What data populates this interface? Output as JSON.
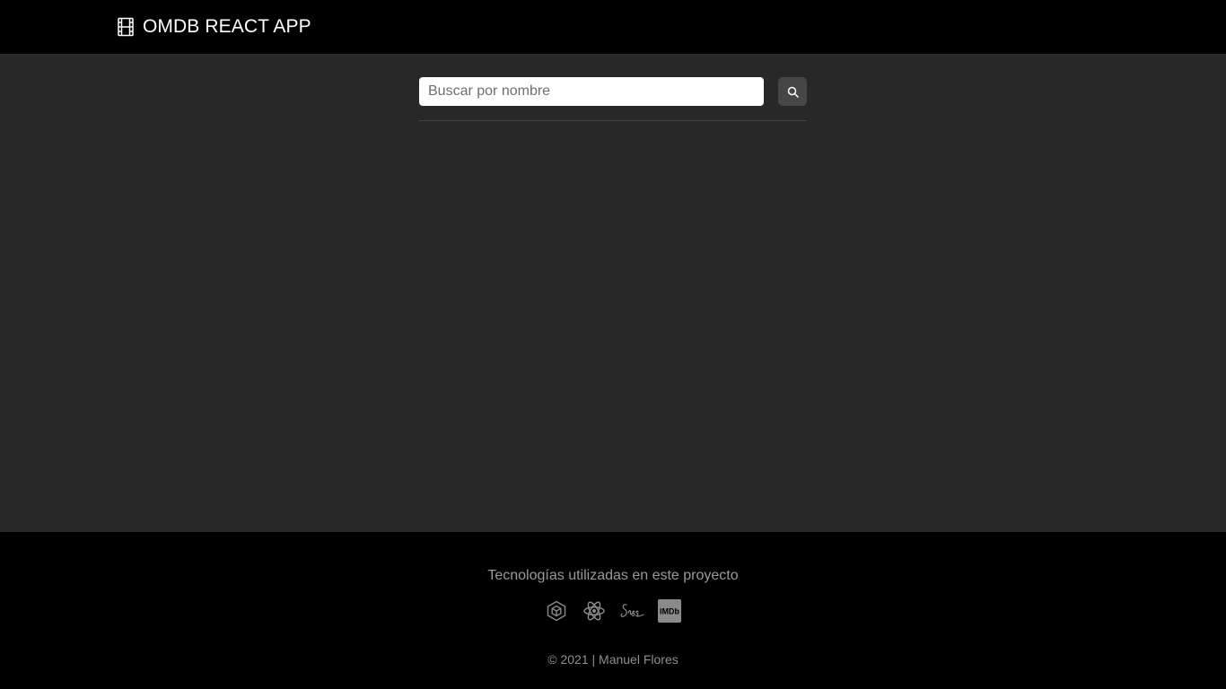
{
  "header": {
    "brand_icon": "film-icon",
    "title": "OMDB REACT APP"
  },
  "search": {
    "placeholder": "Buscar por nombre",
    "value": "",
    "button_icon": "search-icon"
  },
  "footer": {
    "technologies_label": "Tecnologías utilizadas en este proyecto",
    "technologies": [
      {
        "name": "webpack",
        "icon": "webpack-icon"
      },
      {
        "name": "react",
        "icon": "react-icon"
      },
      {
        "name": "sass",
        "icon": "sass-icon"
      },
      {
        "name": "imdb",
        "icon": "imdb-icon",
        "label": "IMDb"
      }
    ],
    "copyright": "© 2021 | Manuel Flores"
  },
  "colors": {
    "navbar": "#000000",
    "background": "#282828",
    "button": "#464646",
    "icon_gray": "#8a8a8a"
  }
}
